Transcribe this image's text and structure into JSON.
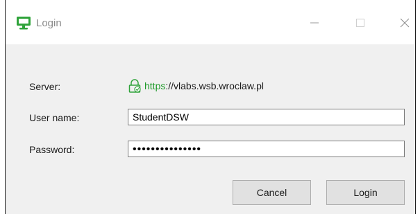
{
  "window": {
    "title": "Login",
    "icon": "monitor-icon"
  },
  "title_controls": {
    "minimize": "minimize-icon",
    "maximize": "maximize-icon",
    "close": "close-icon"
  },
  "form": {
    "server_label": "Server:",
    "server_scheme": "https",
    "server_rest": "://vlabs.wsb.wroclaw.pl",
    "username_label": "User name:",
    "username_value": "StudentDSW",
    "password_label": "Password:",
    "password_mask": "•••••••••••••••"
  },
  "buttons": {
    "cancel": "Cancel",
    "login": "Login"
  },
  "colors": {
    "accent_green": "#1e9a2a",
    "window_bg": "#f0f0f0"
  }
}
